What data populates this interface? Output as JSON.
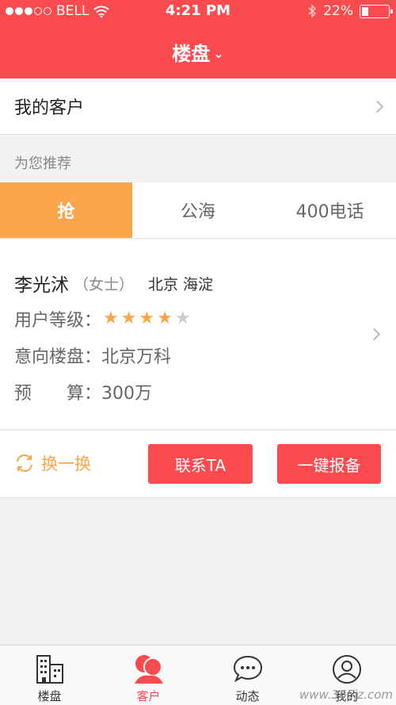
{
  "status_bar": {
    "carrier": "BELL",
    "time": "4:21 PM",
    "battery": "22%",
    "battery_level": 0.22
  },
  "nav": {
    "title": "楼盘",
    "title_chevron": "⌄"
  },
  "my_customers": {
    "label": "我的客户"
  },
  "recommend": {
    "section_title": "为您推荐",
    "tabs": [
      {
        "label": "抢",
        "active": true
      },
      {
        "label": "公海",
        "active": false
      },
      {
        "label": "400电话",
        "active": false
      }
    ]
  },
  "customer": {
    "name": "李光沭",
    "gender": "（女士）",
    "location": "北京 海淀",
    "level_label": "用户等级：",
    "level_stars": 4,
    "level_max": 5,
    "intent_label": "意向楼盘：",
    "intent_value": "北京万科",
    "budget_label": "预　　算：",
    "budget_value": "300万"
  },
  "actions": {
    "refresh_label": "换一换",
    "contact_label": "联系TA",
    "report_label": "一键报备"
  },
  "tabbar": {
    "items": [
      {
        "label": "楼盘",
        "icon": "building-icon",
        "active": false
      },
      {
        "label": "客户",
        "icon": "customers-icon",
        "active": true
      },
      {
        "label": "动态",
        "icon": "chat-bubble-icon",
        "active": false
      },
      {
        "label": "我的",
        "icon": "user-profile-icon",
        "active": false
      }
    ]
  },
  "colors": {
    "primary_red": "#fb4b4e",
    "accent_orange": "#fca54b"
  },
  "watermark": "www.365jz.com"
}
